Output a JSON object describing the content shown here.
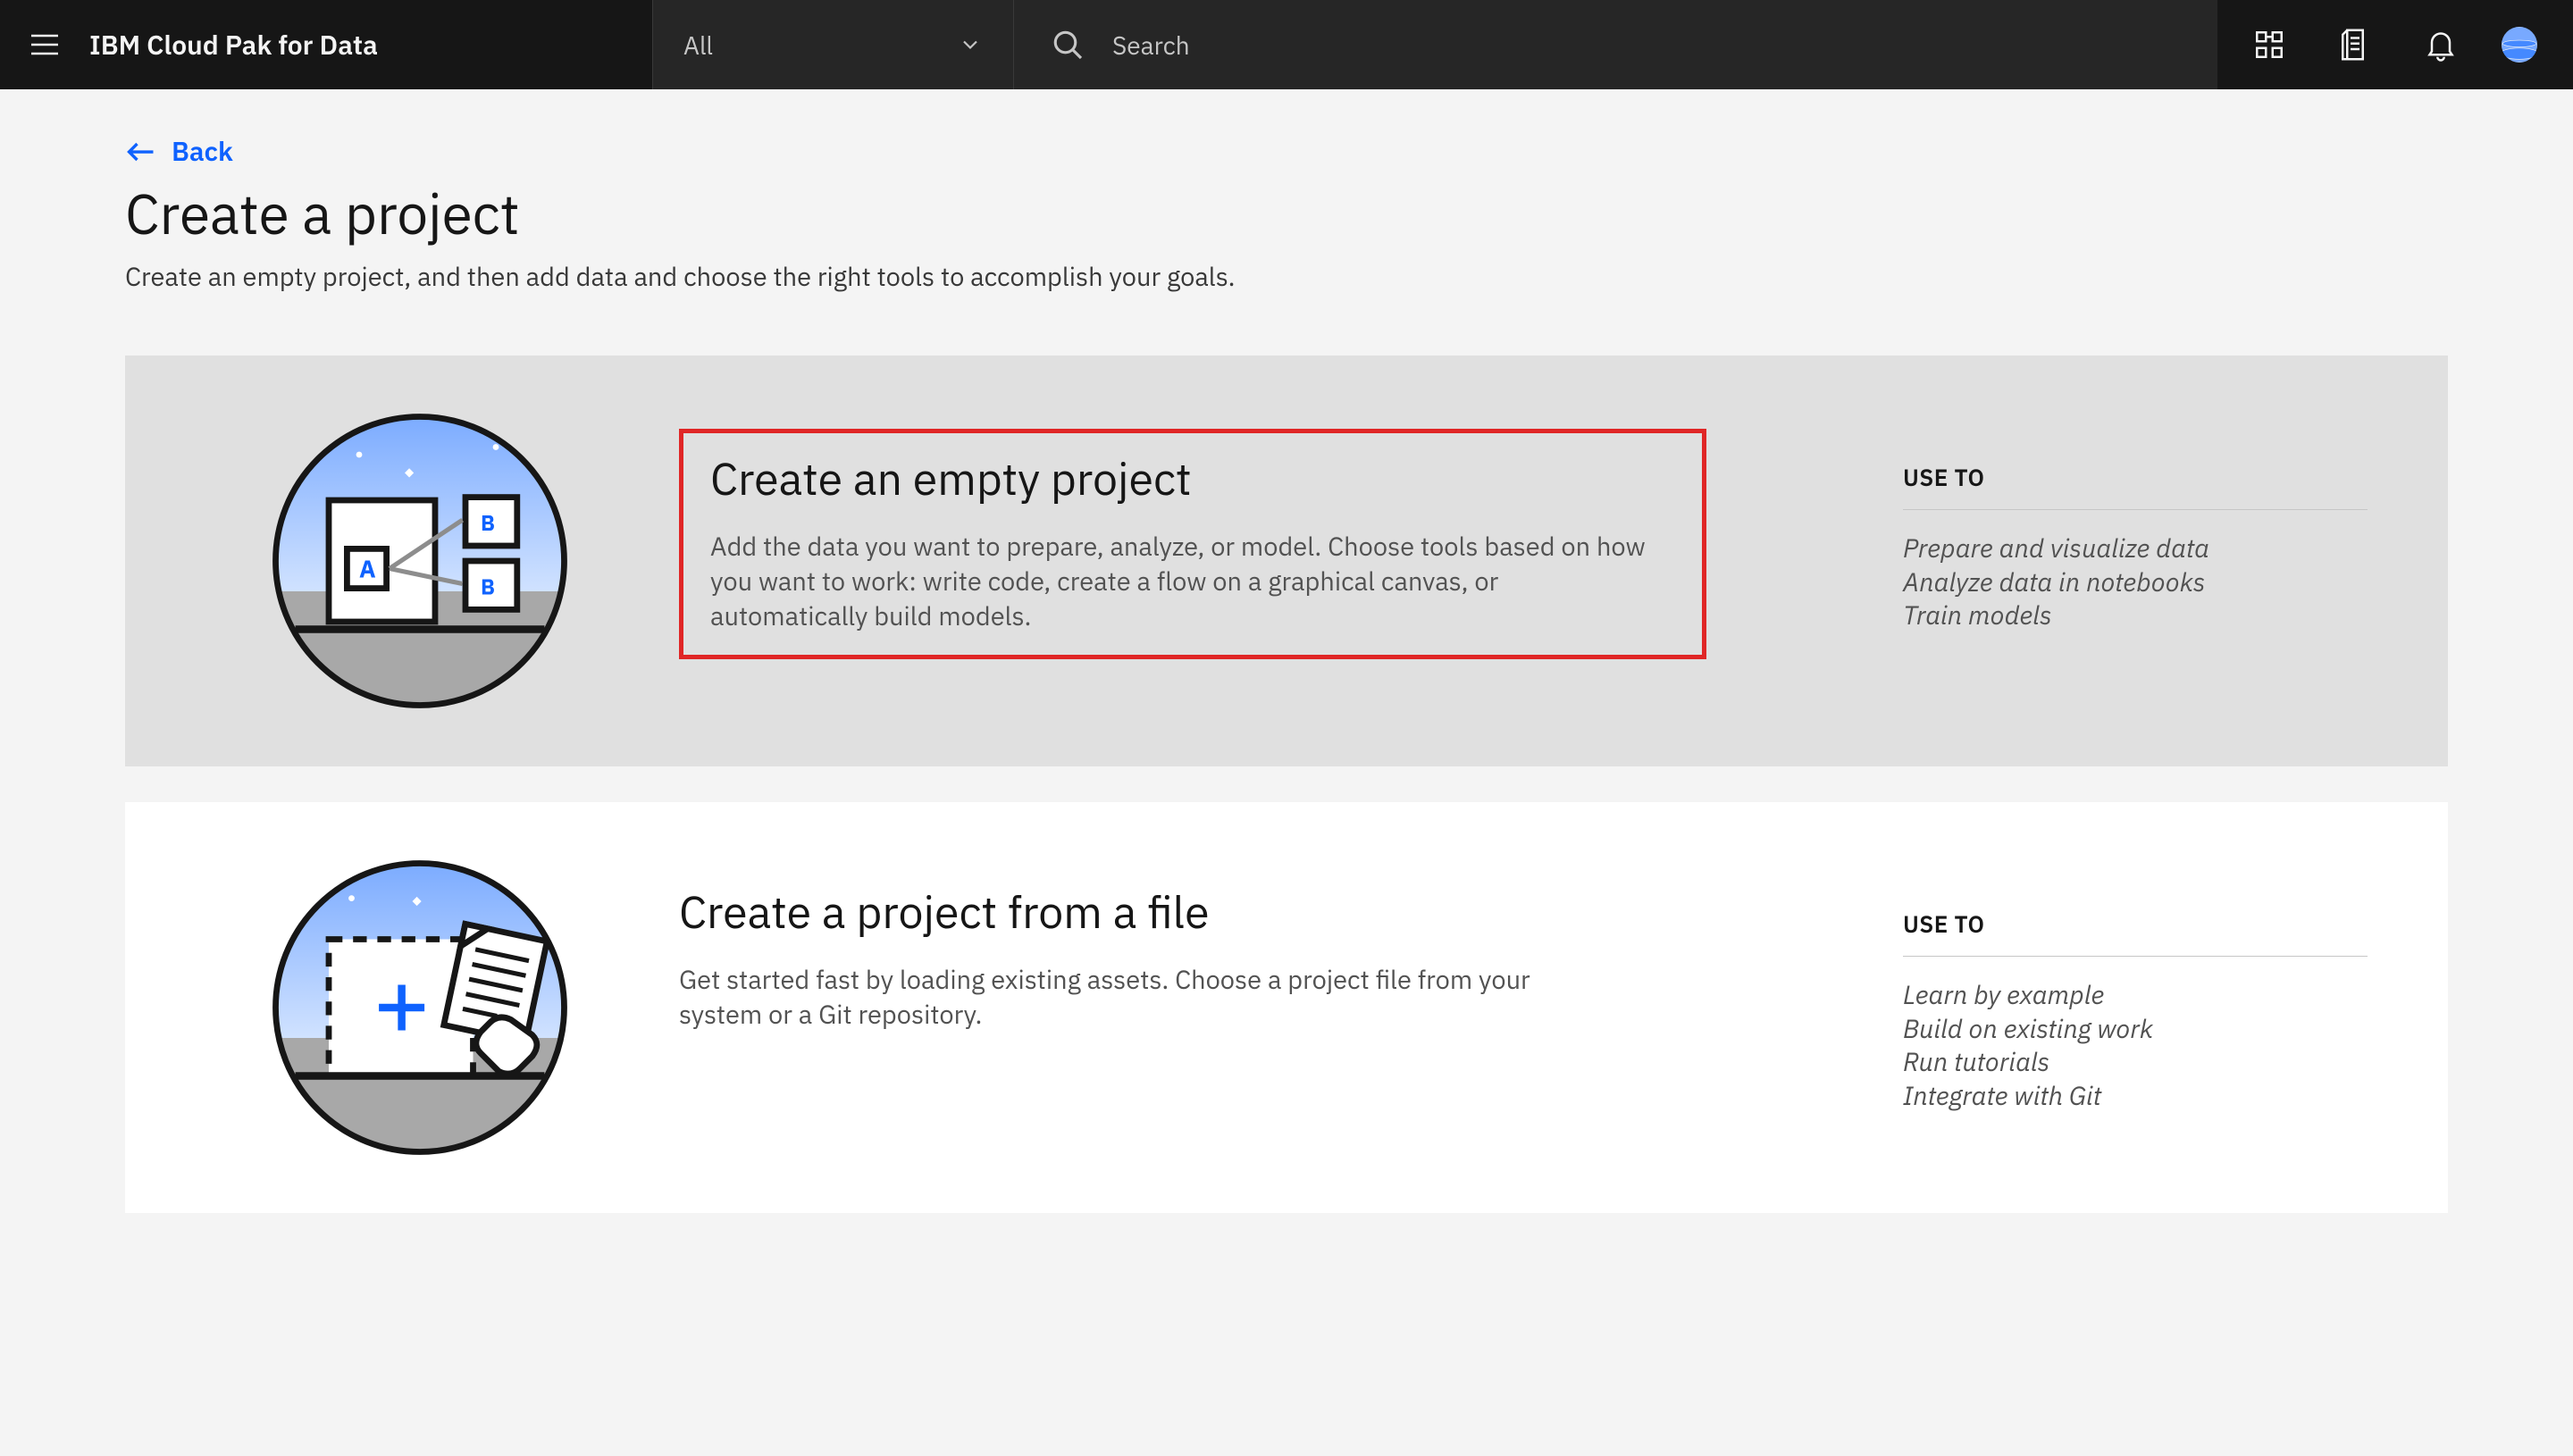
{
  "header": {
    "product": "IBM Cloud Pak for Data",
    "filter_label": "All",
    "search_placeholder": "Search"
  },
  "page": {
    "back_label": "Back",
    "title": "Create a project",
    "subtitle": "Create an empty project, and then add data and choose the right tools to accomplish your goals."
  },
  "cards": [
    {
      "title": "Create an empty project",
      "desc": "Add the data you want to prepare, analyze, or model. Choose tools based on how you want to work: write code, create a flow on a graphical canvas, or automatically build models.",
      "useto_heading": "USE TO",
      "useto": [
        "Prepare and visualize data",
        "Analyze data in notebooks",
        "Train models"
      ]
    },
    {
      "title": "Create a project from a file",
      "desc": "Get started fast by loading existing assets. Choose a project file from your system or a Git repository.",
      "useto_heading": "USE TO",
      "useto": [
        "Learn by example",
        "Build on existing work",
        "Run tutorials",
        "Integrate with Git"
      ]
    }
  ]
}
